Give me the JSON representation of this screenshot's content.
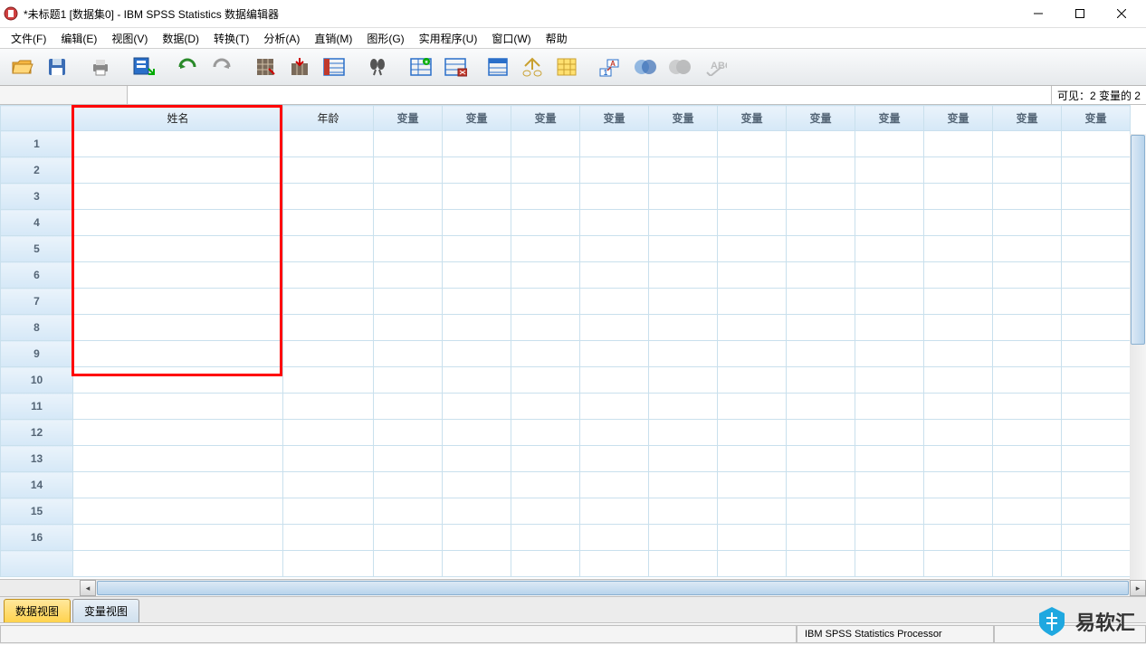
{
  "window": {
    "title": "*未标题1 [数据集0] - IBM SPSS Statistics 数据编辑器"
  },
  "menu": {
    "file": "文件(F)",
    "edit": "编辑(E)",
    "view": "视图(V)",
    "data": "数据(D)",
    "transform": "转换(T)",
    "analyze": "分析(A)",
    "direct": "直销(M)",
    "graphs": "图形(G)",
    "utilities": "实用程序(U)",
    "window": "窗口(W)",
    "help": "帮助"
  },
  "visibility_label": "可见：2 变量的 2",
  "columns": {
    "name": "姓名",
    "age": "年龄",
    "placeholder": "变量"
  },
  "rows": [
    "1",
    "2",
    "3",
    "4",
    "5",
    "6",
    "7",
    "8",
    "9",
    "10",
    "11",
    "12",
    "13",
    "14",
    "15",
    "16",
    ""
  ],
  "tabs": {
    "data_view": "数据视图",
    "variable_view": "变量视图"
  },
  "status": {
    "processor": "IBM SPSS Statistics Processor"
  },
  "watermark": "易软汇"
}
